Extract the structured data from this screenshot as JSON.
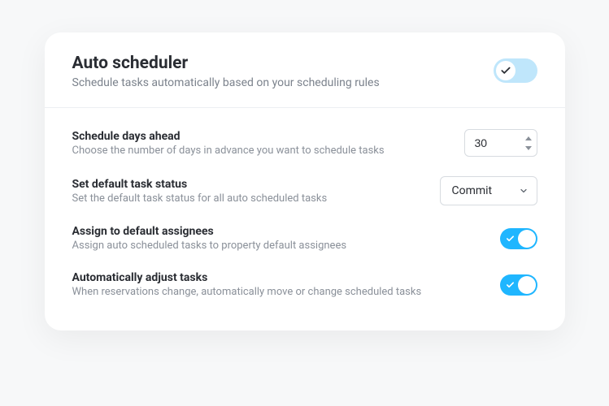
{
  "header": {
    "title": "Auto scheduler",
    "subtitle": "Schedule tasks automatically based on your scheduling rules",
    "enabled": true
  },
  "settings": {
    "days_ahead": {
      "label": "Schedule days ahead",
      "desc": "Choose the number of days in advance you want to schedule tasks",
      "value": "30"
    },
    "default_status": {
      "label": "Set default task status",
      "desc": "Set the default task status for all auto scheduled tasks",
      "value": "Commit"
    },
    "assign_default": {
      "label": "Assign to default assignees",
      "desc": "Assign auto scheduled tasks to property default assignees",
      "enabled": true
    },
    "auto_adjust": {
      "label": "Automatically adjust tasks",
      "desc": "When reservations change, automatically move or change scheduled tasks",
      "enabled": true
    }
  },
  "colors": {
    "accent": "#1fb6ff",
    "pale_accent": "#bfe6fb"
  }
}
